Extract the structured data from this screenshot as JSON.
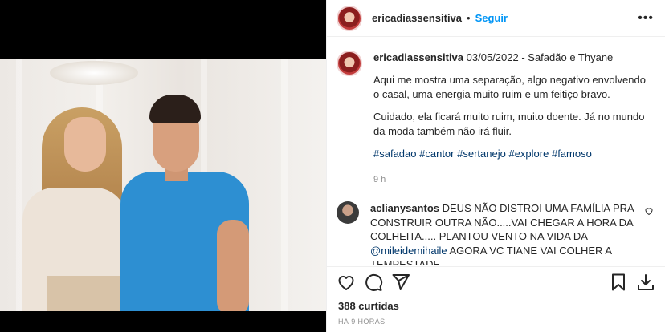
{
  "header": {
    "username": "ericadiassensitiva",
    "separator": "•",
    "follow_label": "Seguir",
    "more_label": "•••"
  },
  "caption": {
    "username": "ericadiassensitiva",
    "headline": "03/05/2022 - Safadão e Thyane",
    "paragraph1": "Aqui me mostra uma separação, algo negativo envolvendo o casal, uma energia muito ruim e um feitiço bravo.",
    "paragraph2": "Cuidado, ela ficará muito ruim, muito doente. Já no mundo da moda também não irá fluir.",
    "hashtags": [
      "#safadao",
      "#cantor",
      "#sertanejo",
      "#explore",
      "#famoso"
    ],
    "time": "9 h"
  },
  "comment": {
    "username": "aclianysantos",
    "text_part1": "DEUS NÃO DISTROI UMA FAMÍLIA PRA CONSTRUIR OUTRA NÃO.....VAI CHEGAR A HORA DA COLHEITA..... PLANTOU VENTO NA VIDA DA ",
    "mention": "@mileidemihaile",
    "text_part2": " AGORA VC TIANE VAI COLHER A TEMPESTADE"
  },
  "actions": {
    "icons": [
      "heart-icon",
      "comment-icon",
      "share-icon",
      "bookmark-icon",
      "download-icon"
    ]
  },
  "likes_label": "388 curtidas",
  "posted_ago": "HÁ 9 HORAS"
}
